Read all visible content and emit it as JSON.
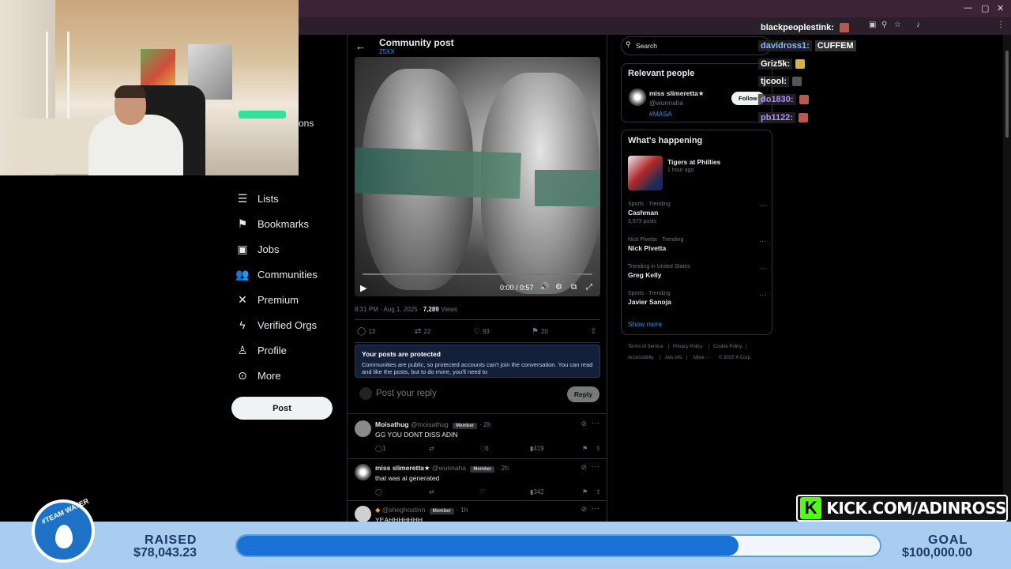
{
  "nav": {
    "partial_label": "ons",
    "items": [
      {
        "label": "Lists",
        "icon": "lists-icon"
      },
      {
        "label": "Bookmarks",
        "icon": "bookmark-icon"
      },
      {
        "label": "Jobs",
        "icon": "briefcase-icon"
      },
      {
        "label": "Communities",
        "icon": "communities-icon"
      },
      {
        "label": "Premium",
        "icon": "x-logo-icon"
      },
      {
        "label": "Verified Orgs",
        "icon": "lightning-icon"
      },
      {
        "label": "Profile",
        "icon": "person-icon"
      },
      {
        "label": "More",
        "icon": "more-circle-icon"
      }
    ],
    "post_label": "Post"
  },
  "main": {
    "title": "Community post",
    "community": "25XX",
    "video": {
      "time": "0:00 / 0:57"
    },
    "meta": {
      "time": "8:31 PM · Aug 1, 2025 · ",
      "views_count": "7,289",
      "views_label": " Views"
    },
    "actions": {
      "replies": "13",
      "reposts": "22",
      "likes": "93",
      "bookmarks": "20"
    },
    "protected": {
      "title": "Your posts are protected",
      "body": "Communities are public, so protected accounts can't join the conversation. You can read and like the posts, but to do more, you'll need to"
    },
    "reply_placeholder": "Post your reply",
    "reply_button": "Reply",
    "replies": [
      {
        "name": "Moisathug",
        "handle": "@moisathug",
        "badge": "Member",
        "time": "· 2h",
        "text": "GG YOU DONT DISS ADIN",
        "replies": "1",
        "likes": "6",
        "views": "419"
      },
      {
        "name": "miss slimeretta★",
        "handle": "@wunnaha",
        "badge": "Member",
        "time": "· 2h",
        "text": "that was ai generated",
        "replies": "",
        "likes": "",
        "views": "342"
      },
      {
        "name": "",
        "handle": "@sheghostinn",
        "badge": "Member",
        "time": "· 1h",
        "text": "YEAHHHHHHH",
        "replies": "",
        "likes": "",
        "views": ""
      }
    ]
  },
  "right": {
    "search_placeholder": "Search",
    "relevant_title": "Relevant people",
    "person": {
      "name": "miss slimeretta★",
      "handle": "@wunnaha",
      "tag": "#MASA",
      "follow": "Follow"
    },
    "happening_title": "What's happening",
    "event": {
      "title": "Tigers at Phillies",
      "time": "1 hour ago"
    },
    "trends": [
      {
        "context": "Sports · Trending",
        "name": "Cashman",
        "posts": "3,573 posts"
      },
      {
        "context": "Nick Pivetta · Trending",
        "name": "Nick Pivetta",
        "posts": ""
      },
      {
        "context": "Trending in United States",
        "name": "Greg Kelly",
        "posts": ""
      },
      {
        "context": "Sports · Trending",
        "name": "Javier Sanoja",
        "posts": ""
      }
    ],
    "show_more": "Show more",
    "footer": [
      "Terms of Service",
      "|",
      "Privacy Policy",
      "|",
      "Cookie Policy",
      "|",
      "Accessibility",
      "|",
      "Ads info",
      "|",
      "More ···",
      "© 2025 X Corp."
    ]
  },
  "chat": [
    {
      "user": "blackpeoplestink:",
      "msg": "",
      "color": "#ffffff"
    },
    {
      "user": "davidross1:",
      "msg": "CUFFEM",
      "color": "#8fb4ff"
    },
    {
      "user": "Griz5k:",
      "msg": "",
      "color": "#ffffff"
    },
    {
      "user": "tjcool:",
      "msg": "",
      "color": "#ffffff"
    },
    {
      "user": "do1830:",
      "msg": "",
      "color": "#b38cff"
    },
    {
      "user": "pb1122:",
      "msg": "",
      "color": "#b38cff"
    }
  ],
  "kick": {
    "text": "KICK.COM/ADINROSS",
    "brand_color": "#53fc18"
  },
  "donation": {
    "team": "#TEAM WATER",
    "raised_label": "RAISED",
    "raised_value": "$78,043.23",
    "goal_label": "GOAL",
    "goal_value": "$100,000.00",
    "progress_fraction": 0.78
  }
}
